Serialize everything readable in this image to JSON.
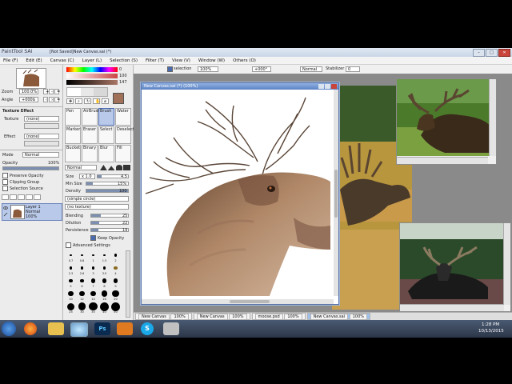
{
  "app": {
    "title": "PaintTool SAI",
    "document_title": "[Not Saved]New Canvas.sai (*)",
    "menu": [
      "File (F)",
      "Edit (E)",
      "Canvas (C)",
      "Layer (L)",
      "Selection (S)",
      "Filter (T)",
      "View (V)",
      "Window (W)",
      "Others (O)"
    ]
  },
  "toolbar": {
    "selection_label": "selection",
    "zoom": "100%",
    "angle": "+000°",
    "blend_mode": "Normal",
    "stabilizer_label": "Stabilizer",
    "stabilizer_value": "0"
  },
  "left_panel": {
    "zoom_label": "Zoom",
    "zoom_value": "100.0%",
    "angle_label": "Angle",
    "angle_value": "+000$",
    "texture_section": "Texture Effect",
    "texture_label": "Texture",
    "texture_value": "(none)",
    "effect_label": "Effect",
    "effect_value": "(none)",
    "mode_label": "Mode",
    "mode_value": "Normal",
    "opacity_label": "Opacity",
    "opacity_value": "100%",
    "preserve_opacity": "Preserve Opacity",
    "clipping_group": "Clipping Group",
    "selection_source": "Selection Source",
    "layer_name": "Layer 1",
    "layer_mode": "Normal",
    "layer_opacity": "100%"
  },
  "tool_panel": {
    "value1": "0",
    "value2": "100",
    "value3": "147",
    "tools_row1": [
      "Pen",
      "AirBrush",
      "Brush",
      "Water"
    ],
    "tools_row2": [
      "Marker",
      "Eraser",
      "Select",
      "Deselect"
    ],
    "tools_row3": [
      "Bucket",
      "Binary",
      "Blur",
      "Fill"
    ],
    "normal_label": "Normal",
    "size_label": "Size",
    "size_mult": "x 1.0",
    "size_value": "4.5",
    "minsize_label": "Min Size",
    "minsize_value": "15%",
    "density_label": "Density",
    "density_value": "100",
    "simple_circle": "(simple circle)",
    "no_texture": "(no texture)",
    "blending_label": "Blending",
    "blending_value": "25",
    "dilution_label": "Dilution",
    "dilution_value": "22",
    "persistence_label": "Persistence",
    "persistence_value": "19",
    "keep_opacity": "Keep Opacity",
    "advanced_settings": "Advanced Settings",
    "brush_sizes": [
      "0.7",
      "0.8",
      "1",
      "1.5",
      "2",
      "2.3",
      "2.6",
      "3",
      "3.5",
      "4",
      "5",
      "6",
      "7",
      "8",
      "9",
      "10",
      "12",
      "14",
      "16",
      "20",
      "25",
      "30",
      "35",
      "40",
      "50"
    ]
  },
  "canvas_window": {
    "title": "New Canvas.sai (*) (100%)"
  },
  "doc_tabs": [
    {
      "name": "New Canvas",
      "zoom": "100%"
    },
    {
      "name": "New Canvas",
      "zoom": "100%"
    },
    {
      "name": "moose.psd",
      "zoom": "100%"
    },
    {
      "name": "New Canvas.sai",
      "zoom": "100%"
    }
  ],
  "taskbar": {
    "time": "1:28 PM",
    "date": "10/13/2015",
    "apps": [
      "start",
      "firefox",
      "explorer",
      "sai",
      "photoshop",
      "office",
      "skype",
      "paint"
    ]
  },
  "colors": {
    "accent": "#5d83c4",
    "taskbar": "#2c3648",
    "canvas_bg": "#ffffff"
  }
}
